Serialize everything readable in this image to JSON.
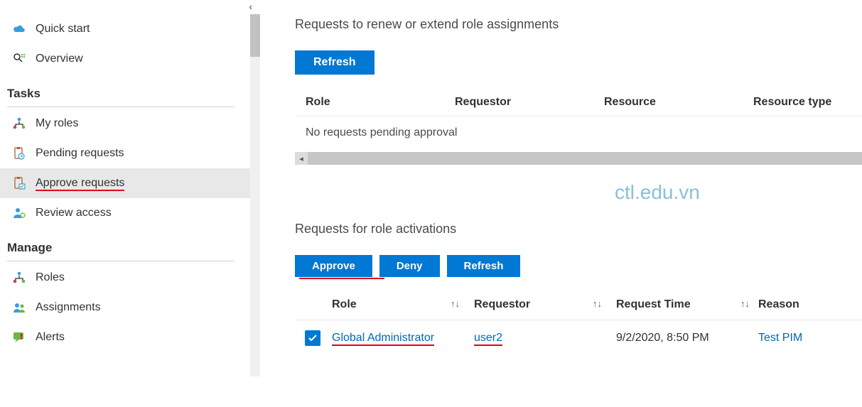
{
  "sidebar": {
    "items": [
      {
        "label": "Quick start"
      },
      {
        "label": "Overview"
      }
    ],
    "tasks_header": "Tasks",
    "tasks": [
      {
        "label": "My roles"
      },
      {
        "label": "Pending requests"
      },
      {
        "label": "Approve requests"
      },
      {
        "label": "Review access"
      }
    ],
    "manage_header": "Manage",
    "manage": [
      {
        "label": "Roles"
      },
      {
        "label": "Assignments"
      },
      {
        "label": "Alerts"
      }
    ]
  },
  "main": {
    "section1": {
      "title": "Requests to renew or extend role assignments",
      "refresh_label": "Refresh",
      "cols": {
        "role": "Role",
        "requestor": "Requestor",
        "resource": "Resource",
        "rtype": "Resource type"
      },
      "empty": "No requests pending approval"
    },
    "watermark": "ctl.edu.vn",
    "section2": {
      "title": "Requests for role activations",
      "approve_label": "Approve",
      "deny_label": "Deny",
      "refresh_label": "Refresh",
      "cols": {
        "role": "Role",
        "requestor": "Requestor",
        "time": "Request Time",
        "reason": "Reason"
      },
      "row": {
        "role": "Global Administrator",
        "requestor": "user2",
        "time": "9/2/2020, 8:50 PM",
        "reason": "Test PIM"
      }
    }
  }
}
